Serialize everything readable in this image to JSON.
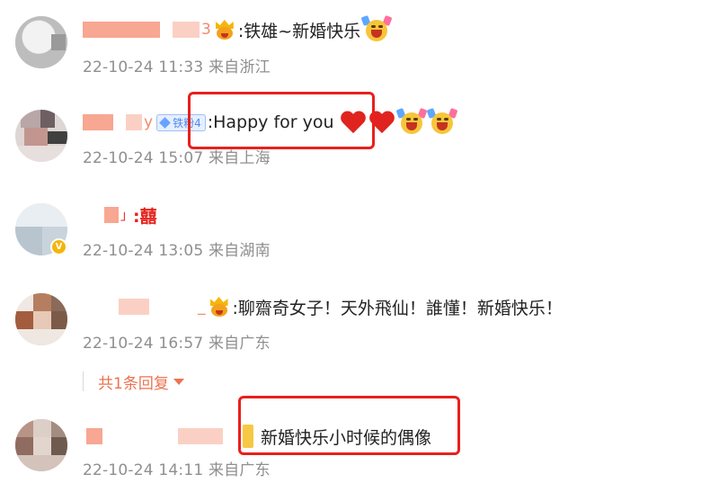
{
  "comments": [
    {
      "username": "3",
      "text": ":铁雄~新婚快乐",
      "date": "22-10-24 11:33",
      "location": "来自浙江"
    },
    {
      "username": "y",
      "fan_badge": "铁粉4",
      "text": ":Happy for you",
      "date": "22-10-24 15:07",
      "location": "来自上海"
    },
    {
      "username": "」",
      "text": ":囍",
      "date": "22-10-24 13:05",
      "location": "来自湖南"
    },
    {
      "username": "_",
      "text": ":聊齋奇女子！天外飛仙！誰懂！新婚快乐！",
      "date": "22-10-24 16:57",
      "location": "来自广东",
      "reply_toggle": "共1条回复"
    },
    {
      "text": "新婚快乐小时候的偶像",
      "date": "22-10-24 14:11",
      "location": "来自广东"
    }
  ],
  "colors": {
    "highlight": "#e8201c",
    "meta": "#8f8f8f",
    "reply": "#eb7350",
    "fan_badge": "#4d8af0"
  },
  "icons": [
    "crown-smile-emoji",
    "heart-emoji",
    "cheer-emoji",
    "double-happiness-glyph",
    "caret-down-icon",
    "verified-badge-icon"
  ]
}
